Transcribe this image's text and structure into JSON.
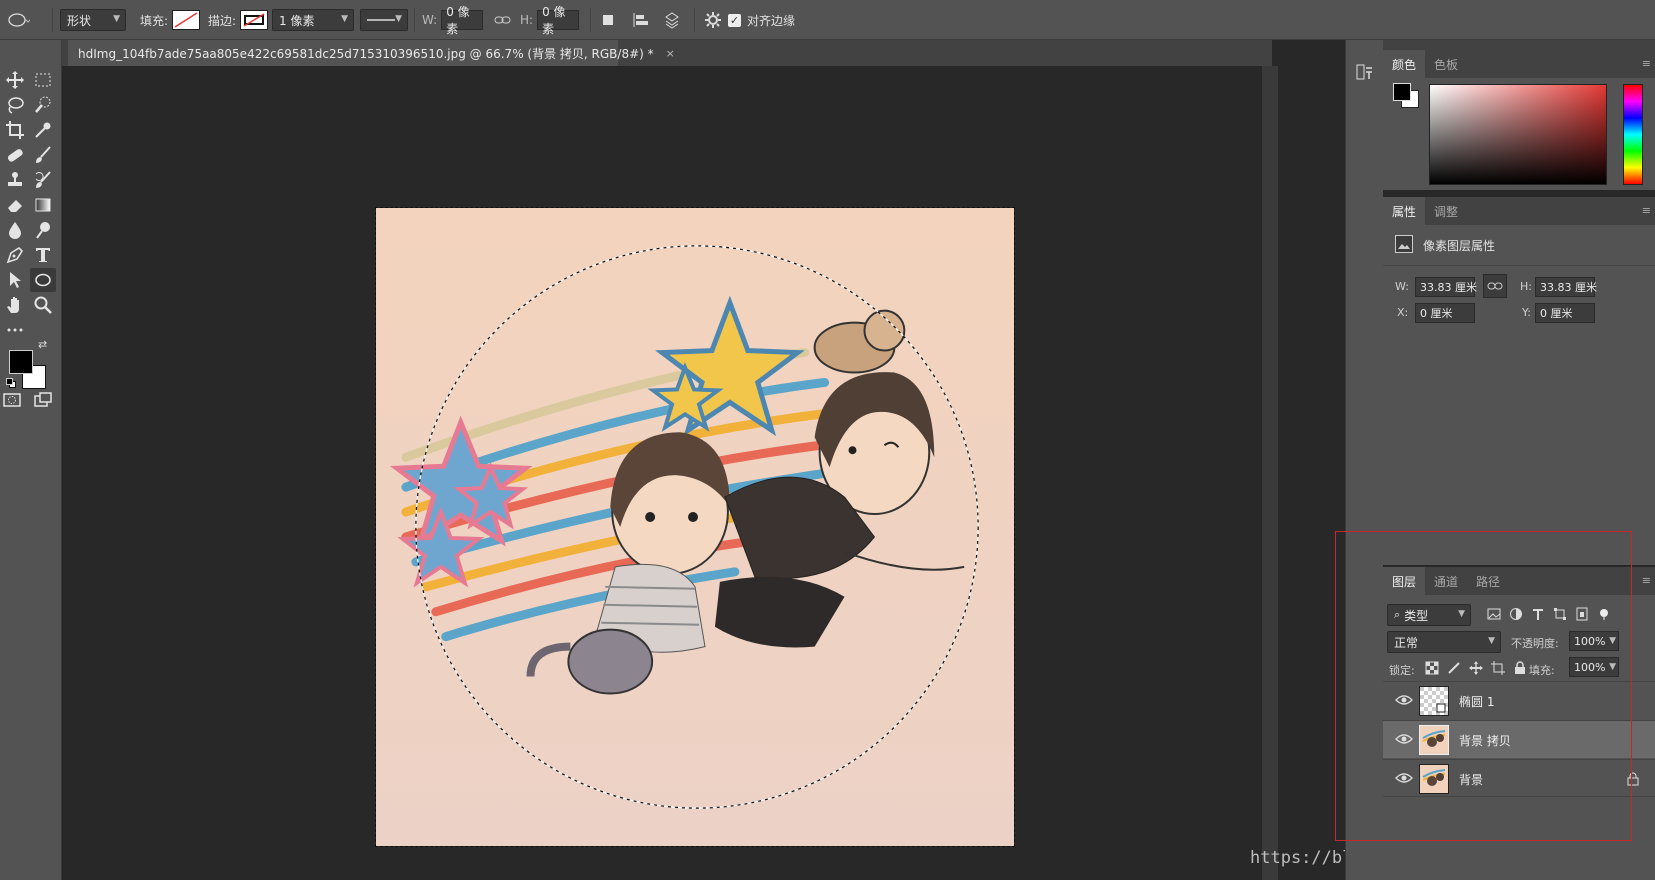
{
  "options_bar": {
    "shape_mode": "形状",
    "fill_label": "填充:",
    "stroke_label": "描边:",
    "stroke_width": "1 像素",
    "w_label": "W:",
    "w_value": "0 像素",
    "h_label": "H:",
    "h_value": "0 像素",
    "align_edges_label": "对齐边缘",
    "align_edges_checked": true
  },
  "document_tab": {
    "title": "hdImg_104fb7ade75aa805e422c69581dc25d715310396510.jpg @ 66.7% (背景 拷贝, RGB/8#) *",
    "close": "×"
  },
  "color_panel": {
    "tabs": [
      "颜色",
      "色板"
    ],
    "active_tab": "颜色",
    "foreground": "#000000",
    "background": "#ffffff",
    "hue_color": "#e53935"
  },
  "properties_panel": {
    "tabs": [
      "属性",
      "调整"
    ],
    "active_tab": "属性",
    "header": "像素图层属性",
    "w_label": "W:",
    "w_value": "33.83 厘米",
    "h_label": "H:",
    "h_value": "33.83 厘米",
    "x_label": "X:",
    "x_value": "0 厘米",
    "y_label": "Y:",
    "y_value": "0 厘米"
  },
  "layers_panel": {
    "tabs": [
      "图层",
      "通道",
      "路径"
    ],
    "active_tab": "图层",
    "filter_kind": "类型",
    "blend_mode": "正常",
    "opacity_label": "不透明度:",
    "opacity_value": "100%",
    "lock_label": "锁定:",
    "fill_label": "填充:",
    "fill_value": "100%",
    "layers": [
      {
        "name": "椭圆 1",
        "selected": false,
        "locked": false
      },
      {
        "name": "背景 拷贝",
        "selected": true,
        "locked": false
      },
      {
        "name": "背景",
        "selected": false,
        "locked": true
      }
    ]
  },
  "watermark": "https://blog.csdn.net/m_nanle_xiaobudiu",
  "colors": {
    "accent_red": "#c62828",
    "panel_bg": "#535353",
    "canvas_bg": "#282828"
  }
}
